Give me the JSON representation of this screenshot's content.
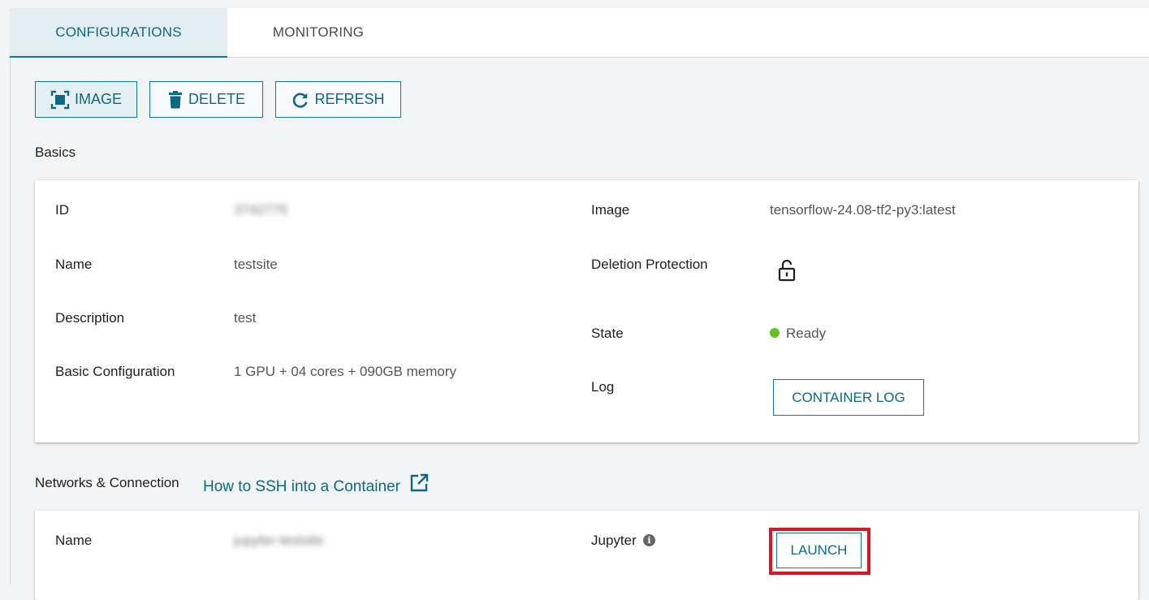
{
  "tabs": [
    {
      "label": "CONFIGURATIONS",
      "active": true
    },
    {
      "label": "MONITORING",
      "active": false
    }
  ],
  "toolbar": {
    "image_label": "IMAGE",
    "delete_label": "DELETE",
    "refresh_label": "REFRESH",
    "image_icon": "image-capture-icon",
    "delete_icon": "trash-icon",
    "refresh_icon": "refresh-icon"
  },
  "basics": {
    "title": "Basics",
    "left": [
      {
        "label": "ID",
        "value": "3742775",
        "obscured": true
      },
      {
        "label": "Name",
        "value": "testsite"
      },
      {
        "label": "Description",
        "value": "test"
      },
      {
        "label": "Basic Configuration",
        "value": "1 GPU + 04 cores + 090GB memory"
      }
    ],
    "image_label": "Image",
    "image_value": "tensorflow-24.08-tf2-py3:latest",
    "deletion_protection_label": "Deletion Protection",
    "deletion_protection_icon": "unlocked-padlock-icon",
    "state_label": "State",
    "state_value": "Ready",
    "state_color": "#5ec41f",
    "log_label": "Log",
    "container_log_button": "CONTAINER LOG"
  },
  "networks": {
    "title": "Networks & Connection",
    "ssh_link": "How to SSH into a Container",
    "ssh_link_icon": "external-link-icon",
    "name_label": "Name",
    "name_value": "jupyter-testsite",
    "name_obscured": true,
    "jupyter_label": "Jupyter",
    "jupyter_info_icon": "info-icon",
    "launch_button": "LAUNCH"
  },
  "colors": {
    "accent": "#0e7a99",
    "highlight": "#e3141f",
    "background": "#f2f3f4"
  }
}
